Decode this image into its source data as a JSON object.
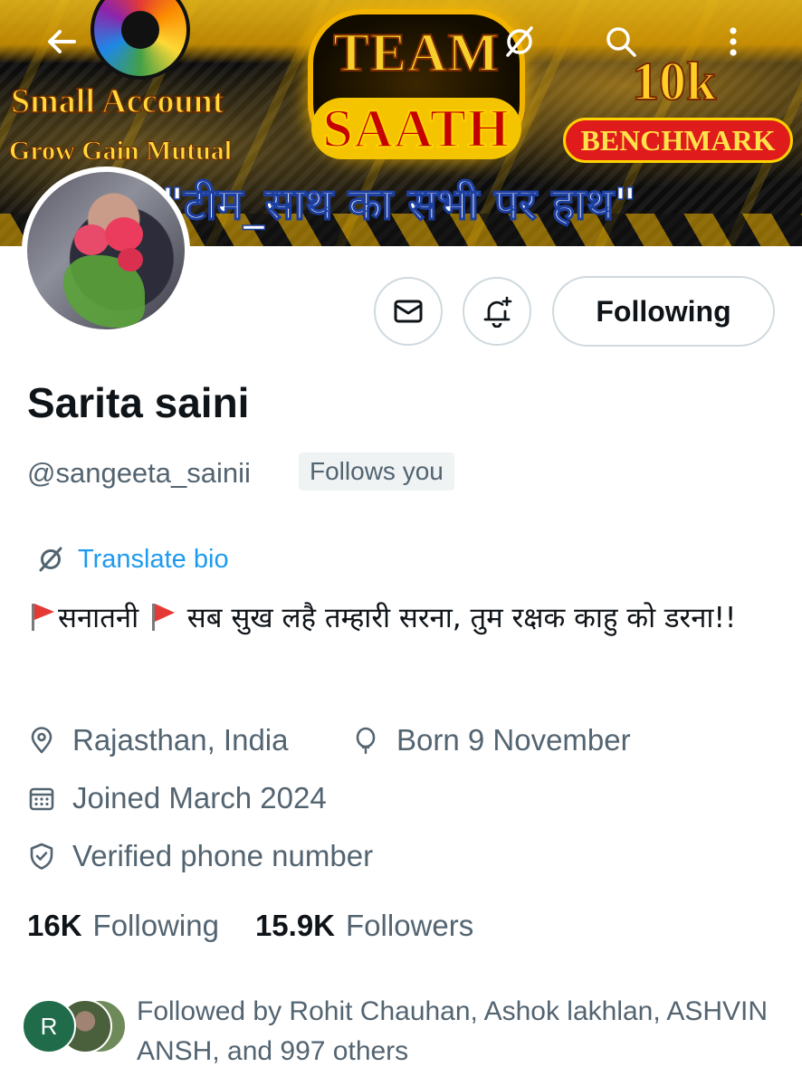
{
  "banner": {
    "small_account": "Small Account",
    "grow_gain": "Grow Gain Mutual",
    "team": "TEAM",
    "saath": "SAATH",
    "tenk": "10k",
    "benchmark": "BENCHMARK",
    "slogan": "\"टीम_साथ का सभी पर हाथ\""
  },
  "top_bar": {
    "back_icon": "arrow-left-icon",
    "translate_icon": "translate-icon",
    "search_icon": "search-icon",
    "more_icon": "more-vertical-icon"
  },
  "actions": {
    "message_icon": "envelope-icon",
    "notify_icon": "bell-plus-icon",
    "following_label": "Following"
  },
  "profile": {
    "display_name": "Sarita saini",
    "handle": "@sangeeta_sainii",
    "follows_you": "Follows you",
    "translate_bio": "Translate bio",
    "bio_part1": "सनातनी",
    "bio_part2": " सब सुख लहै तम्हारी सरना, तुम रक्षक काहु को डरना!!",
    "location": "Rajasthan, India",
    "birthday": "Born 9 November",
    "joined": "Joined March 2024",
    "verified": "Verified phone number"
  },
  "stats": {
    "following_count": "16K",
    "following_label": "Following",
    "followers_count": "15.9K",
    "followers_label": "Followers"
  },
  "followed_by": {
    "avatar_initial": "R",
    "text": "Followed by Rohit Chauhan, Ashok lakhlan, ASHVIN ANSH, and 997 others"
  },
  "colors": {
    "accent": "#1d9bf0",
    "secondary_text": "#536471",
    "primary_text": "#0f1419",
    "border": "#cfd9de"
  }
}
